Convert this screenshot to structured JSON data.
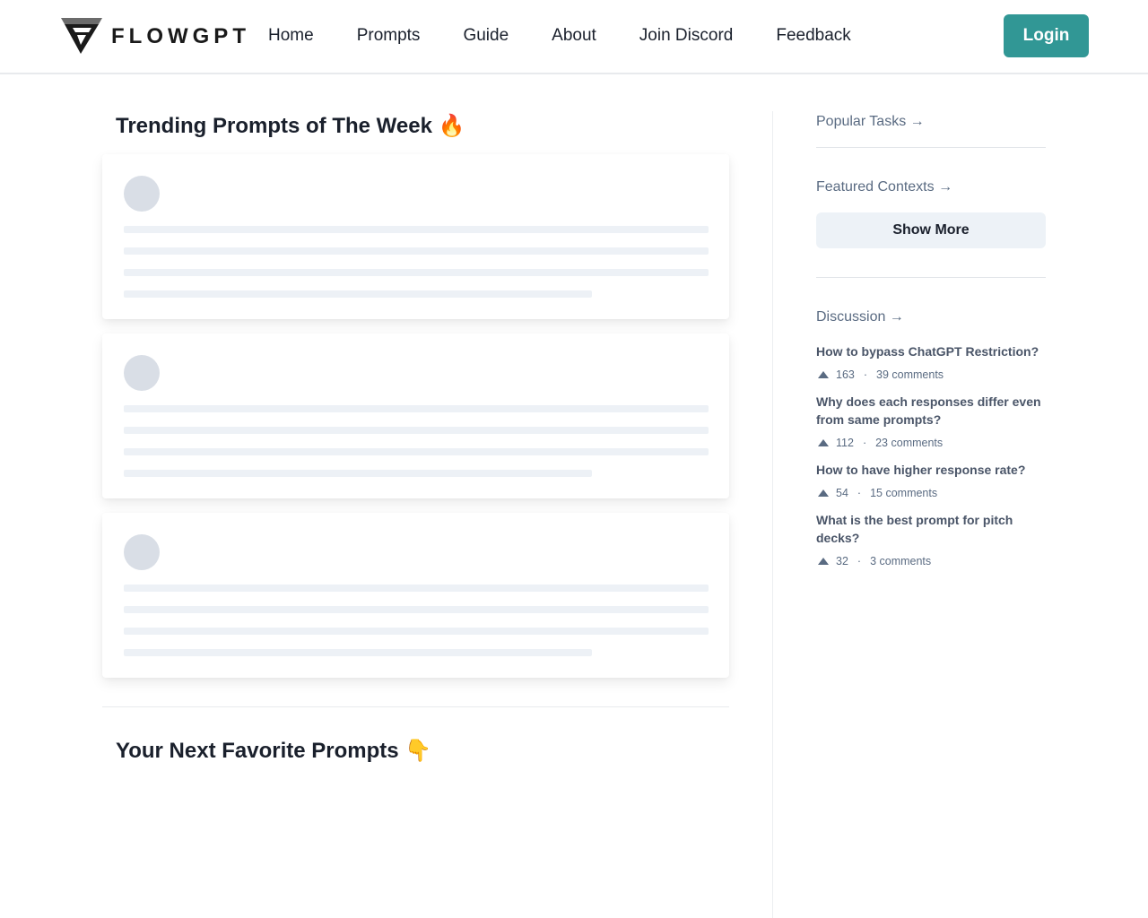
{
  "brand": {
    "name": "FLOWGPT"
  },
  "nav": {
    "items": [
      {
        "label": "Home"
      },
      {
        "label": "Prompts"
      },
      {
        "label": "Guide"
      },
      {
        "label": "About"
      },
      {
        "label": "Join Discord"
      },
      {
        "label": "Feedback"
      }
    ],
    "login_label": "Login"
  },
  "colors": {
    "accent": "#319795",
    "skeleton": "#d9dee6",
    "muted_text": "#5a6b82"
  },
  "main": {
    "trending_title": "Trending Prompts of The Week 🔥",
    "favorites_title": "Your Next Favorite Prompts 👇",
    "loading_cards": 3
  },
  "sidebar": {
    "popular_tasks": "Popular Tasks →",
    "featured_contexts": "Featured Contexts →",
    "show_more": "Show More",
    "discussion": "Discussion →",
    "discussions": [
      {
        "title": "How to bypass ChatGPT Restriction?",
        "votes": "163",
        "comments": "39 comments"
      },
      {
        "title": "Why does each responses differ even from same prompts?",
        "votes": "112",
        "comments": "23 comments"
      },
      {
        "title": "How to have higher response rate?",
        "votes": "54",
        "comments": "15 comments"
      },
      {
        "title": "What is the best prompt for pitch decks?",
        "votes": "32",
        "comments": "3 comments"
      }
    ]
  }
}
